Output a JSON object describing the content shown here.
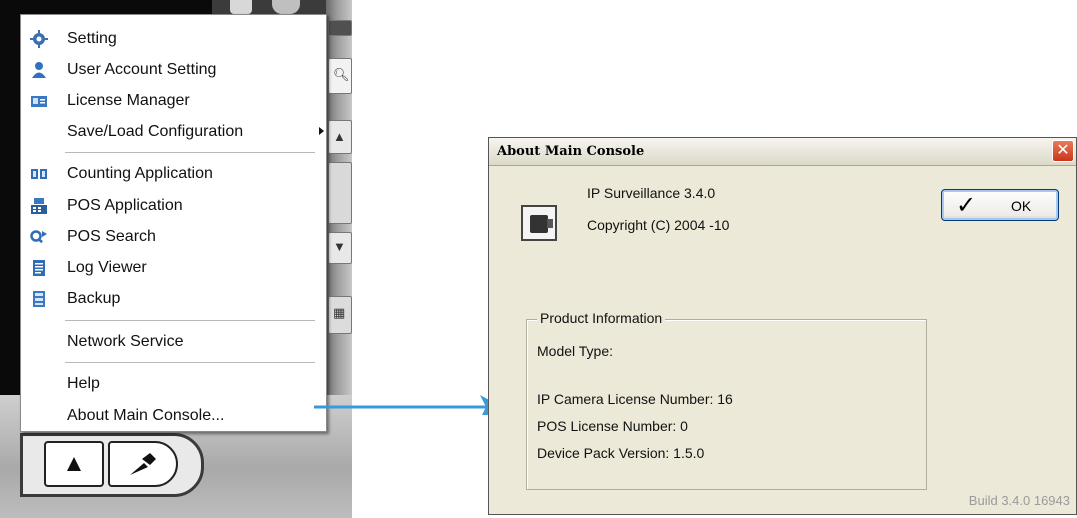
{
  "context_menu": {
    "items": [
      {
        "label": "Setting",
        "icon": "gear-icon",
        "submenu": false
      },
      {
        "label": "User Account Setting",
        "icon": "user-icon",
        "submenu": false
      },
      {
        "label": "License Manager",
        "icon": "license-card-icon",
        "submenu": false
      },
      {
        "label": "Save/Load Configuration",
        "icon": "",
        "submenu": true
      },
      {
        "label": "Counting Application",
        "icon": "counting-icon",
        "submenu": false
      },
      {
        "label": "POS Application",
        "icon": "pos-register-icon",
        "submenu": false
      },
      {
        "label": "POS Search",
        "icon": "search-arrow-icon",
        "submenu": false
      },
      {
        "label": "Log Viewer",
        "icon": "document-icon",
        "submenu": false
      },
      {
        "label": "Backup",
        "icon": "backup-icon",
        "submenu": false
      },
      {
        "label": "Network Service",
        "icon": "",
        "submenu": false
      },
      {
        "label": "Help",
        "icon": "",
        "submenu": false
      },
      {
        "label": "About Main Console...",
        "icon": "",
        "submenu": false
      }
    ]
  },
  "background_app": {
    "bottom_buttons": [
      "warning-icon",
      "wrench-icon"
    ]
  },
  "about_dialog": {
    "title": "About Main Console",
    "product_name": "IP Surveillance 3.4.0",
    "copyright": "Copyright (C) 2004 -10",
    "ok_label": "OK",
    "group_title": "Product Information",
    "model_type_label": "Model Type:",
    "ip_camera_license": "IP Camera License Number: 16",
    "pos_license": "POS License Number: 0",
    "device_pack_version": "Device Pack Version:  1.5.0",
    "build": "Build 3.4.0 16943"
  },
  "colors": {
    "arrow": "#3a9ad9",
    "dialog_bg": "#ece9d8",
    "close_button": "#d9482a"
  }
}
